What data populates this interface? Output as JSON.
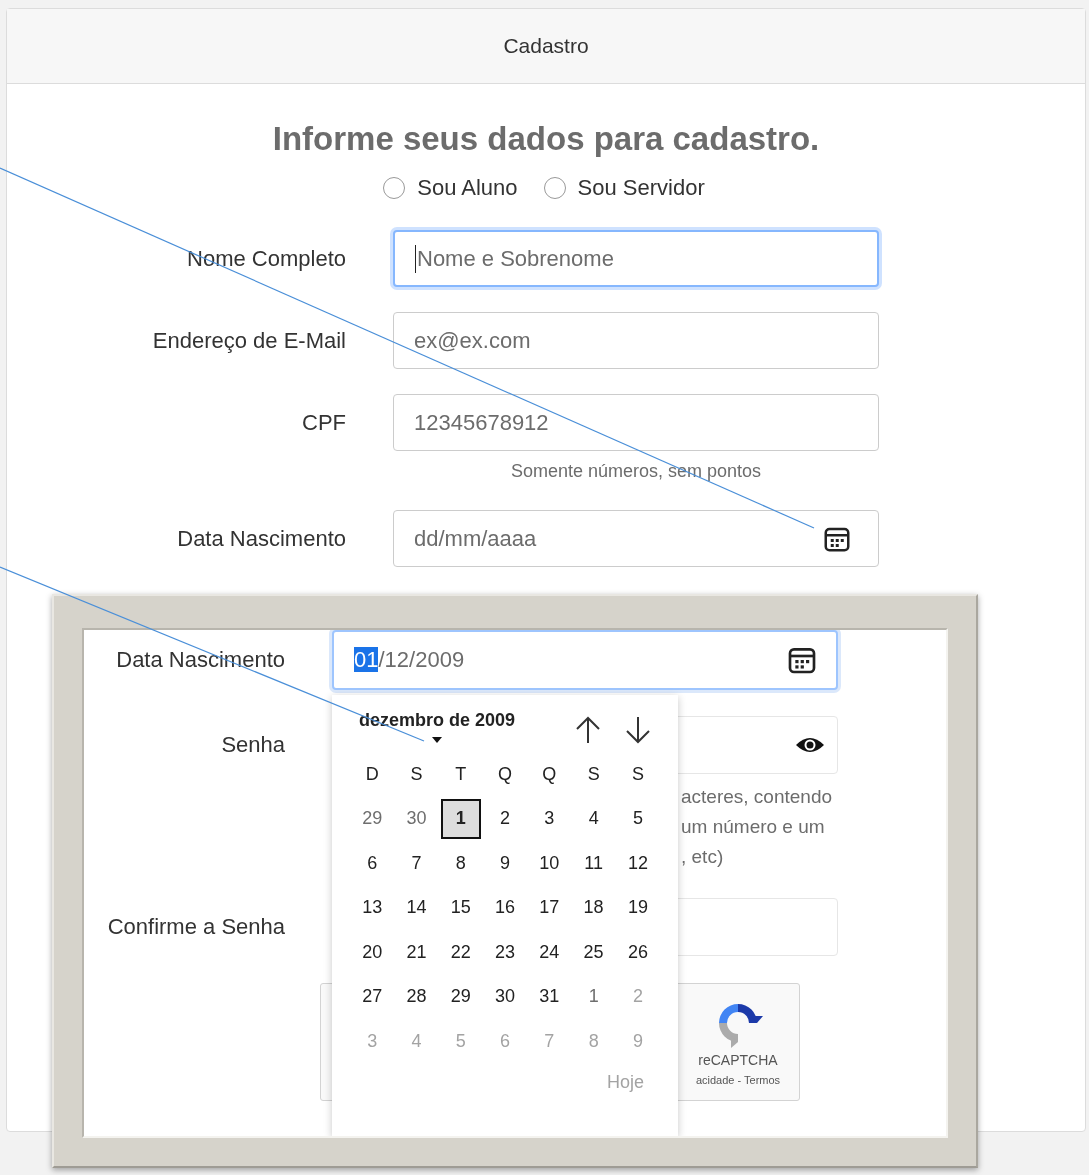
{
  "card": {
    "title": "Cadastro"
  },
  "heading": "Informe seus dados para cadastro.",
  "user_type": [
    {
      "label": "Sou Aluno",
      "selected": false
    },
    {
      "label": "Sou Servidor",
      "selected": false
    }
  ],
  "fields": [
    {
      "label": "Nome Completo",
      "placeholder": "Nome e Sobrenome",
      "kind": "text",
      "focused": true
    },
    {
      "label": "Endereço de E-Mail",
      "placeholder": "ex@ex.com",
      "kind": "text",
      "focused": false
    },
    {
      "label": "CPF",
      "placeholder": "12345678912",
      "kind": "text",
      "focused": false,
      "hint": "Somente números, sem pontos"
    },
    {
      "label": "Data Nascimento",
      "placeholder": "dd/mm/aaaa",
      "kind": "date",
      "focused": false
    }
  ],
  "inset": {
    "date_field": {
      "label": "Data Nascimento",
      "selected_part": "01",
      "rest": "/12/2009",
      "focused": true
    },
    "password": {
      "label": "Senha",
      "hint_lines": [
        "acteres, contendo",
        "um número e um",
        ", etc)"
      ]
    },
    "confirm_password": {
      "label": "Confirme a Senha"
    },
    "recaptcha": {
      "brand": "reCAPTCHA",
      "links": "acidade - Termos"
    },
    "calendar": {
      "month": "dezembro de 2009",
      "weekdays": [
        "D",
        "S",
        "T",
        "Q",
        "Q",
        "S",
        "S"
      ],
      "days": [
        {
          "label": "29",
          "kind": "adjacent",
          "selected": false
        },
        {
          "label": "30",
          "kind": "adjacent",
          "selected": false
        },
        {
          "label": "1",
          "kind": "current",
          "selected": true
        },
        {
          "label": "2",
          "kind": "current",
          "selected": false
        },
        {
          "label": "3",
          "kind": "current",
          "selected": false
        },
        {
          "label": "4",
          "kind": "current",
          "selected": false
        },
        {
          "label": "5",
          "kind": "current",
          "selected": false
        },
        {
          "label": "6",
          "kind": "current",
          "selected": false
        },
        {
          "label": "7",
          "kind": "current",
          "selected": false
        },
        {
          "label": "8",
          "kind": "current",
          "selected": false
        },
        {
          "label": "9",
          "kind": "current",
          "selected": false
        },
        {
          "label": "10",
          "kind": "current",
          "selected": false
        },
        {
          "label": "11",
          "kind": "current",
          "selected": false
        },
        {
          "label": "12",
          "kind": "current",
          "selected": false
        },
        {
          "label": "13",
          "kind": "current",
          "selected": false
        },
        {
          "label": "14",
          "kind": "current",
          "selected": false
        },
        {
          "label": "15",
          "kind": "current",
          "selected": false
        },
        {
          "label": "16",
          "kind": "current",
          "selected": false
        },
        {
          "label": "17",
          "kind": "current",
          "selected": false
        },
        {
          "label": "18",
          "kind": "current",
          "selected": false
        },
        {
          "label": "19",
          "kind": "current",
          "selected": false
        },
        {
          "label": "20",
          "kind": "current",
          "selected": false
        },
        {
          "label": "21",
          "kind": "current",
          "selected": false
        },
        {
          "label": "22",
          "kind": "current",
          "selected": false
        },
        {
          "label": "23",
          "kind": "current",
          "selected": false
        },
        {
          "label": "24",
          "kind": "current",
          "selected": false
        },
        {
          "label": "25",
          "kind": "current",
          "selected": false
        },
        {
          "label": "26",
          "kind": "current",
          "selected": false
        },
        {
          "label": "27",
          "kind": "current",
          "selected": false
        },
        {
          "label": "28",
          "kind": "current",
          "selected": false
        },
        {
          "label": "29",
          "kind": "current",
          "selected": false
        },
        {
          "label": "30",
          "kind": "current",
          "selected": false
        },
        {
          "label": "31",
          "kind": "current",
          "selected": false
        },
        {
          "label": "1",
          "kind": "adjacent",
          "selected": false
        },
        {
          "label": "2",
          "kind": "faded",
          "selected": false
        },
        {
          "label": "3",
          "kind": "faded",
          "selected": false
        },
        {
          "label": "4",
          "kind": "faded",
          "selected": false
        },
        {
          "label": "5",
          "kind": "faded",
          "selected": false
        },
        {
          "label": "6",
          "kind": "faded",
          "selected": false
        },
        {
          "label": "7",
          "kind": "faded",
          "selected": false
        },
        {
          "label": "8",
          "kind": "faded",
          "selected": false
        },
        {
          "label": "9",
          "kind": "faded",
          "selected": false
        }
      ],
      "today": {
        "label": "Hoje",
        "disabled": true
      }
    }
  }
}
